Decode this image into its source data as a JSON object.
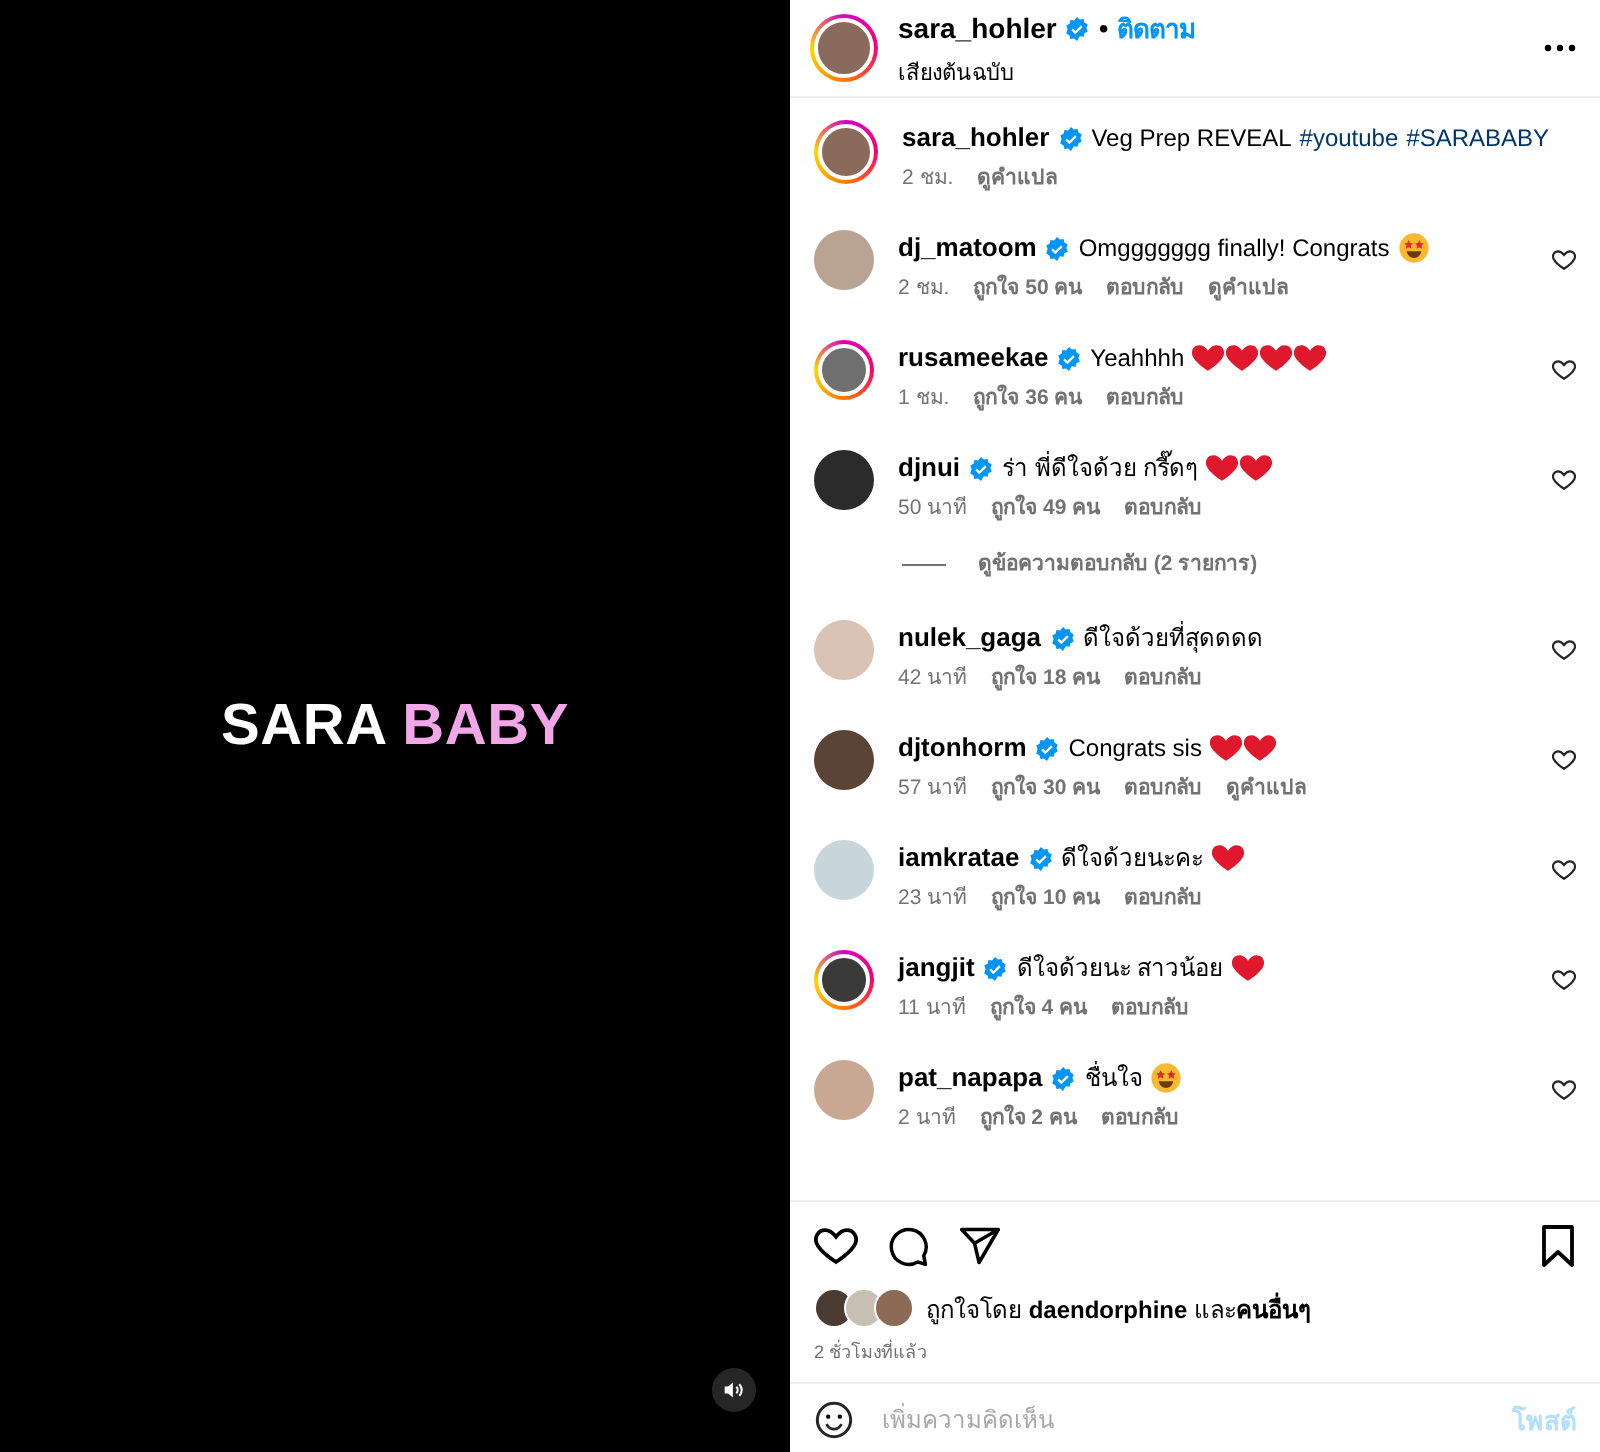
{
  "video": {
    "title_words": [
      {
        "text": "SARA",
        "color": "#ffffff"
      },
      {
        "text": "BABY",
        "color": "#f2a7e8"
      }
    ],
    "muted": false
  },
  "header": {
    "username": "sara_hohler",
    "separator": "•",
    "follow": "ติดตาม",
    "audio": "เสียงต้นฉบับ",
    "story_ring": true
  },
  "caption": {
    "username": "sara_hohler",
    "text": "Veg Prep REVEAL",
    "hashtags": [
      "#youtube",
      "#SARABABY"
    ],
    "meta": [
      "2 ชม.",
      "ดูคำแปล"
    ],
    "story_ring": true
  },
  "comments": [
    {
      "username": "dj_matoom",
      "text": "Omggggggg finally! Congrats",
      "emojis": [
        {
          "kind": "starstruck"
        }
      ],
      "meta": [
        "2 ชม.",
        "ถูกใจ 50 คน",
        "ตอบกลับ",
        "ดูคำแปล"
      ],
      "story_ring": false
    },
    {
      "username": "rusameekae",
      "text": "Yeahhhh",
      "emojis": [
        {
          "kind": "heart"
        },
        {
          "kind": "heart"
        },
        {
          "kind": "heart"
        },
        {
          "kind": "heart"
        }
      ],
      "meta": [
        "1 ชม.",
        "ถูกใจ 36 คน",
        "ตอบกลับ"
      ],
      "story_ring": true
    },
    {
      "username": "djnui",
      "text": "ร่า พี่ดีใจด้วย กรี๊ดๆ",
      "emojis": [
        {
          "kind": "heart"
        },
        {
          "kind": "heart"
        }
      ],
      "meta": [
        "50 นาที",
        "ถูกใจ 49 คน",
        "ตอบกลับ"
      ],
      "story_ring": false,
      "replies": "ดูข้อความตอบกลับ (2 รายการ)"
    },
    {
      "username": "nulek_gaga",
      "text": "ดีใจด้วยที่สุดดดด",
      "meta": [
        "42 นาที",
        "ถูกใจ 18 คน",
        "ตอบกลับ"
      ],
      "story_ring": false
    },
    {
      "username": "djtonhorm",
      "text": "Congrats sis",
      "emojis": [
        {
          "kind": "heart"
        },
        {
          "kind": "heart"
        }
      ],
      "meta": [
        "57 นาที",
        "ถูกใจ 30 คน",
        "ตอบกลับ",
        "ดูคำแปล"
      ],
      "story_ring": false
    },
    {
      "username": "iamkratae",
      "text": "ดีใจด้วยนะคะ",
      "emojis": [
        {
          "kind": "heart"
        }
      ],
      "meta": [
        "23 นาที",
        "ถูกใจ 10 คน",
        "ตอบกลับ"
      ],
      "story_ring": false
    },
    {
      "username": "jangjit",
      "text": "ดีใจด้วยนะ สาวน้อย",
      "emojis": [
        {
          "kind": "heart"
        }
      ],
      "meta": [
        "11 นาที",
        "ถูกใจ 4 คน",
        "ตอบกลับ"
      ],
      "story_ring": true
    },
    {
      "username": "pat_napapa",
      "text": "ชื่นใจ",
      "emojis": [
        {
          "kind": "starstruck"
        }
      ],
      "meta": [
        "2 นาที",
        "ถูกใจ 2 คน",
        "ตอบกลับ"
      ],
      "story_ring": false
    }
  ],
  "likes": {
    "text": "ถูกใจโดย **daendorphine** และ**คนอื่นๆ**",
    "time": "2 ชั่วโมงที่แล้ว"
  },
  "composer": {
    "placeholder": "เพิ่มความคิดเห็น",
    "post": "โพสต์",
    "post_disabled": true
  }
}
